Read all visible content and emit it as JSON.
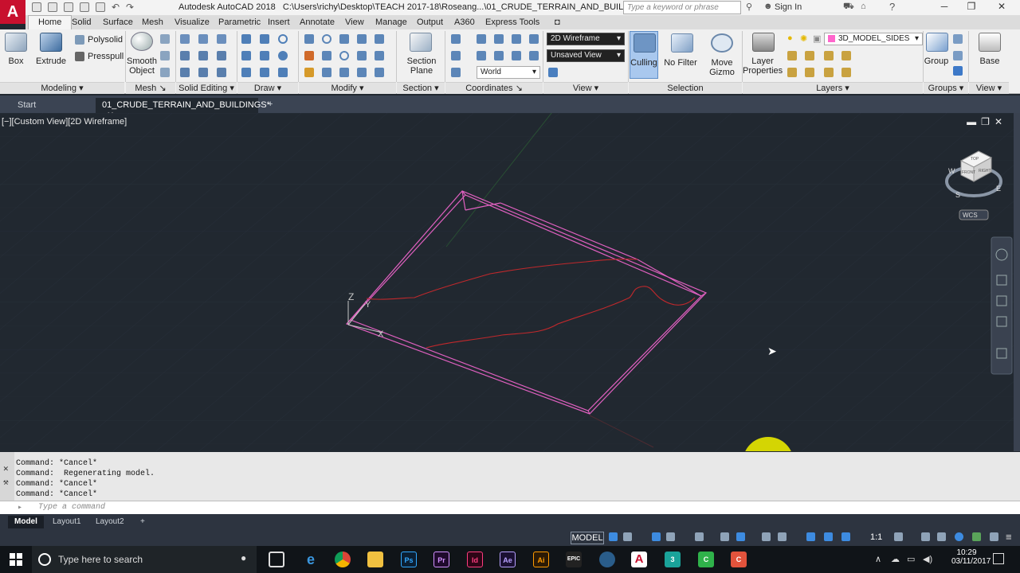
{
  "app": {
    "logo_letter": "A",
    "title": "Autodesk AutoCAD 2018",
    "file_path": "C:\\Users\\richy\\Desktop\\TEACH 2017-18\\Roseang...\\01_CRUDE_TERRAIN_AND_BUILDINGS.dwg",
    "search_placeholder": "Type a keyword or phrase",
    "sign_in": "Sign In"
  },
  "ribbon_tabs": [
    "Home",
    "Solid",
    "Surface",
    "Mesh",
    "Visualize",
    "Parametric",
    "Insert",
    "Annotate",
    "View",
    "Manage",
    "Output",
    "A360",
    "Express Tools"
  ],
  "active_tab": "Home",
  "ribbon": {
    "box": "Box",
    "extrude": "Extrude",
    "polysolid": "Polysolid",
    "presspull": "Presspull",
    "smooth_object_1": "Smooth",
    "smooth_object_2": "Object",
    "section_plane_1": "Section",
    "section_plane_2": "Plane",
    "visual_style": "2D Wireframe",
    "view_name": "Unsaved View",
    "ucs": "World",
    "culling": "Culling",
    "no_filter": "No Filter",
    "move_gizmo_1": "Move",
    "move_gizmo_2": "Gizmo",
    "layer_props_1": "Layer",
    "layer_props_2": "Properties",
    "current_layer": "3D_MODEL_SIDES",
    "group": "Group",
    "base": "Base",
    "panels": [
      "Modeling",
      "Mesh",
      "Solid Editing",
      "Draw",
      "Modify",
      "Section",
      "Coordinates",
      "View",
      "Selection",
      "Layers",
      "Groups",
      "View"
    ]
  },
  "doc_tabs": [
    "Start",
    "01_CRUDE_TERRAIN_AND_BUILDINGS*"
  ],
  "viewport": {
    "label": "[−][Custom View][2D Wireframe]",
    "axis_z": "Z",
    "axis_y": "Y",
    "axis_x": "X",
    "viewcube_top": "TOP",
    "viewcube_front": "FRONT",
    "viewcube_right": "RIGHT",
    "compass_w": "W",
    "compass_s": "S",
    "compass_e": "E",
    "wcs": "WCS",
    "colors": {
      "box": "#e060c0",
      "terrain": "#c0282c",
      "highlight": "#e4e400"
    }
  },
  "command_history": [
    "Command: *Cancel*",
    "Command:  Regenerating model.",
    "Command: *Cancel*",
    "Command: *Cancel*"
  ],
  "command_placeholder": "Type a command",
  "layout_tabs": [
    "Model",
    "Layout1",
    "Layout2"
  ],
  "status": {
    "model": "MODEL",
    "scale": "1:1"
  },
  "taskbar": {
    "search_placeholder": "Type here to search",
    "time": "10:29",
    "date": "03/11/2017"
  }
}
